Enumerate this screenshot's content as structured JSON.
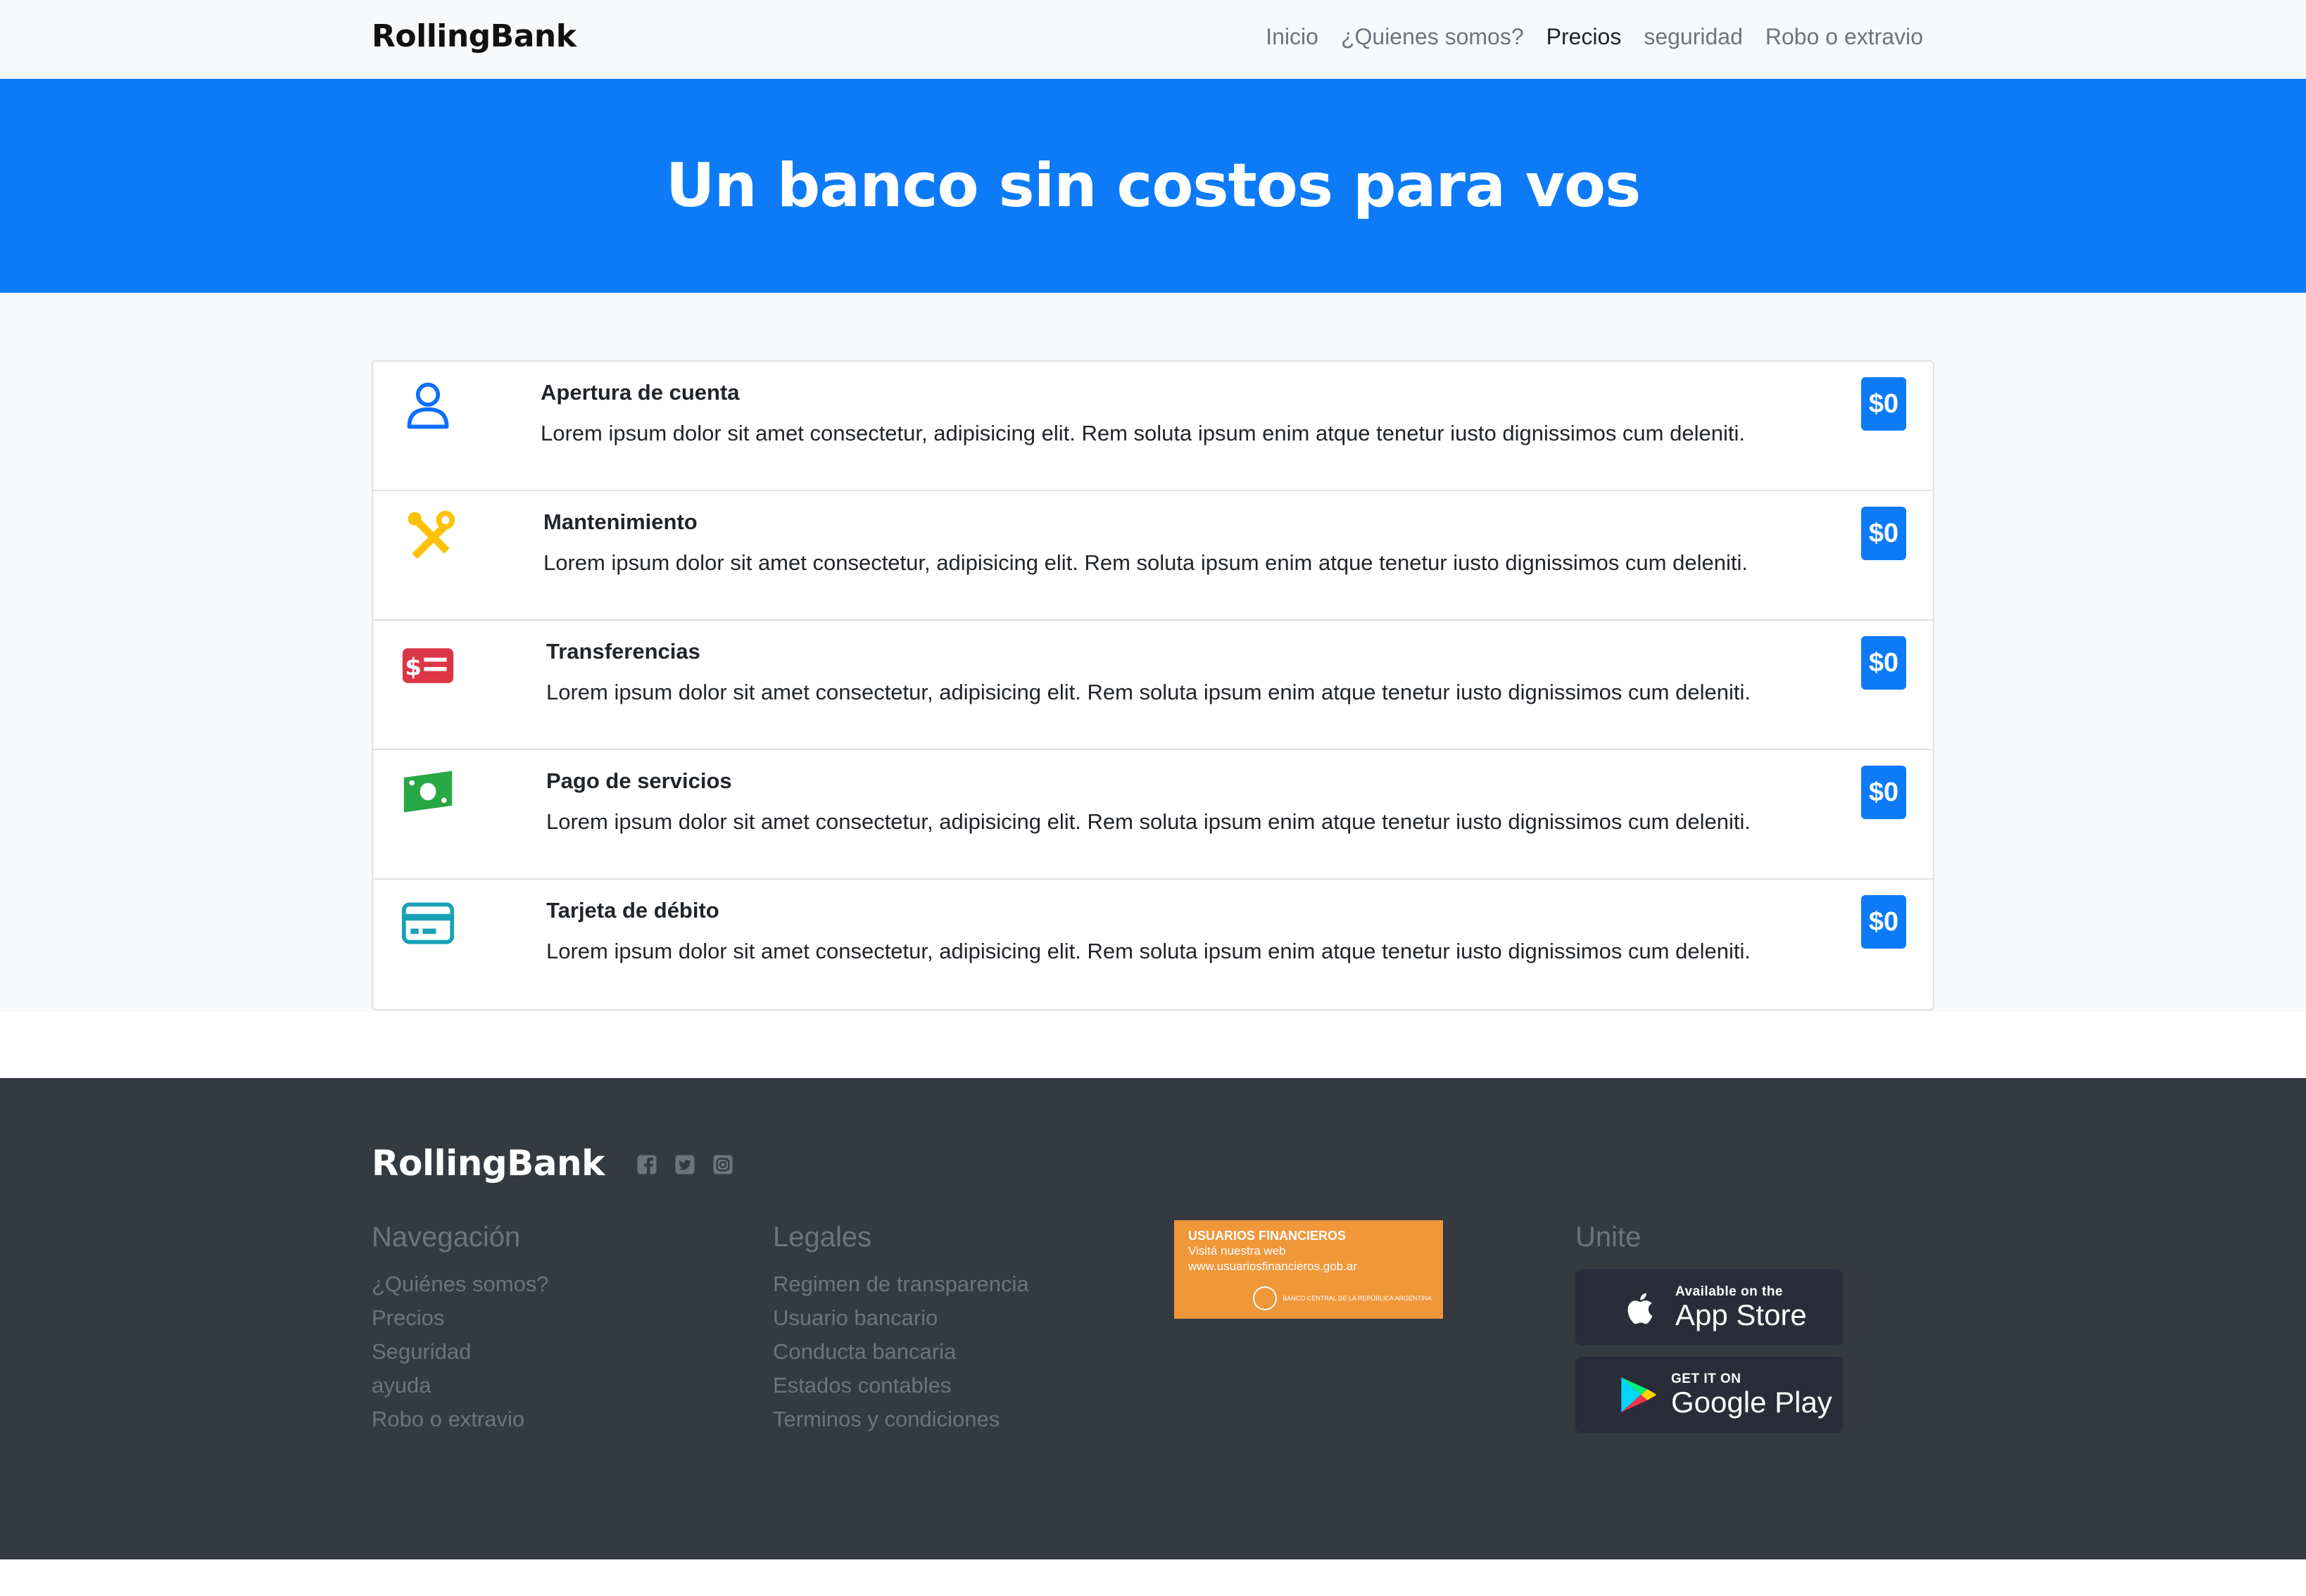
{
  "nav": {
    "brand": "RollingBank",
    "links": [
      "Inicio",
      "¿Quienes somos?",
      "Precios",
      "seguridad",
      "Robo o extravio"
    ],
    "active_index": 2
  },
  "hero": {
    "title": "Un banco sin costos para vos"
  },
  "items": [
    {
      "icon": "person-icon",
      "color": "#0d6efd",
      "title": "Apertura de cuenta",
      "desc": "Lorem ipsum dolor sit amet consectetur, adipisicing elit. Rem soluta ipsum enim atque tenetur iusto dignissimos cum deleniti.",
      "price": "$0"
    },
    {
      "icon": "tools-icon",
      "color": "#ffc107",
      "title": "Mantenimiento",
      "desc": "Lorem ipsum dolor sit amet consectetur, adipisicing elit. Rem soluta ipsum enim atque tenetur iusto dignissimos cum deleniti.",
      "price": "$0"
    },
    {
      "icon": "money-transfer-icon",
      "color": "#dc3545",
      "title": "Transferencias",
      "desc": "Lorem ipsum dolor sit amet consectetur, adipisicing elit. Rem soluta ipsum enim atque tenetur iusto dignissimos cum deleniti.",
      "price": "$0"
    },
    {
      "icon": "cash-icon",
      "color": "#28a745",
      "title": "Pago de servicios",
      "desc": "Lorem ipsum dolor sit amet consectetur, adipisicing elit. Rem soluta ipsum enim atque tenetur iusto dignissimos cum deleniti.",
      "price": "$0"
    },
    {
      "icon": "credit-card-icon",
      "color": "#17a2b8",
      "title": "Tarjeta de débito",
      "desc": "Lorem ipsum dolor sit amet consectetur, adipisicing elit. Rem soluta ipsum enim atque tenetur iusto dignissimos cum deleniti.",
      "price": "$0"
    }
  ],
  "footer": {
    "brand": "RollingBank",
    "socials": [
      "facebook-icon",
      "twitter-icon",
      "instagram-icon"
    ],
    "navegacion": {
      "title": "Navegación",
      "links": [
        "¿Quiénes somos?",
        "Precios",
        "Seguridad",
        "ayuda",
        "Robo o extravio"
      ]
    },
    "legales": {
      "title": "Legales",
      "links": [
        "Regimen de transparencia",
        "Usuario bancario",
        "Conducta bancaria",
        "Estados contables",
        "Terminos y condiciones"
      ]
    },
    "banner": {
      "line1": "USUARIOS FINANCIEROS",
      "line2": "Visitá nuestra web",
      "line3": "www.usuariosfinancieros.gob.ar",
      "line4": "BANCO CENTRAL DE LA REPÚBLICA ARGENTINA"
    },
    "unite": {
      "title": "Unite",
      "appstore_small": "Available on the",
      "appstore_big": "App Store",
      "googleplay_small": "GET IT ON",
      "googleplay_big": "Google Play"
    }
  }
}
